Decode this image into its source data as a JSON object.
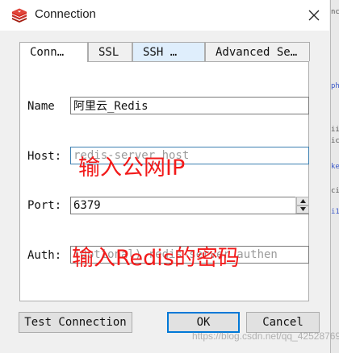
{
  "window": {
    "title": "Connection",
    "icon": "redis-logo-icon",
    "close_icon": "close-icon"
  },
  "tabs": [
    {
      "label": "Conn…",
      "active": true
    },
    {
      "label": "SSL",
      "active": false
    },
    {
      "label": "SSH …",
      "active": false
    },
    {
      "label": "Advanced Se…",
      "active": false
    }
  ],
  "form": {
    "name": {
      "label": "Name",
      "value": "阿里云_Redis"
    },
    "host": {
      "label": "Host:",
      "value": "",
      "placeholder": "redis-server host"
    },
    "port": {
      "label": "Port:",
      "value": "6379"
    },
    "auth": {
      "label": "Auth:",
      "value": "",
      "placeholder": "(Optional) redis-server authen"
    }
  },
  "annotations": {
    "host_note": "输入公网IP",
    "auth_note": "输入Redis的密码"
  },
  "buttons": {
    "test": "Test Connection",
    "ok": "OK",
    "cancel": "Cancel"
  },
  "watermark": "https://blog.csdn.net/qq_42528769",
  "background_fragments": [
    "nc",
    "ph",
    "ii",
    "ic",
    "ke",
    "ci",
    "i1"
  ],
  "colors": {
    "annotation": "#f21b1b",
    "focus_border": "#3c7fb1",
    "default_button_border": "#0078d7",
    "hover_tab": "#dfeefc"
  }
}
